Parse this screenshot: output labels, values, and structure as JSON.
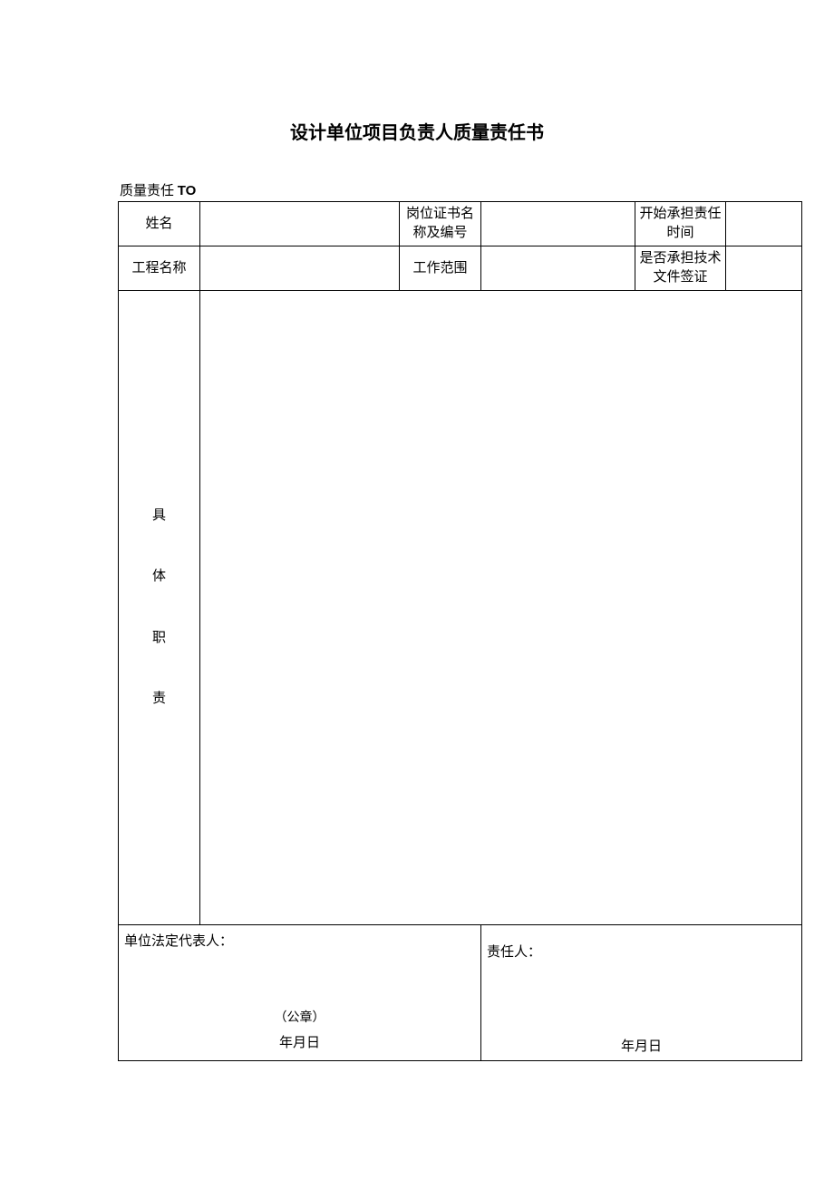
{
  "title": "设计单位项目负责人质量责任书",
  "subtitle_prefix": "质量责任 ",
  "subtitle_to": "TO",
  "row1": {
    "label1": "姓名",
    "val1": "",
    "label2": "岗位证书名称及编号",
    "val2": "",
    "label3": "开始承担责任时间",
    "val3": ""
  },
  "row2": {
    "label1": "工程名称",
    "val1": "",
    "label2": "工作范围",
    "val2": "",
    "label3": "是否承担技术文件签证",
    "val3": ""
  },
  "duties": {
    "label_chars": [
      "具",
      "体",
      "职",
      "责"
    ],
    "content": ""
  },
  "signatures": {
    "legal_rep_label": "单位法定代表人：",
    "seal_label": "（公章）",
    "date_left": "年月日",
    "responsible_label": "责任人：",
    "date_right": "年月日"
  }
}
